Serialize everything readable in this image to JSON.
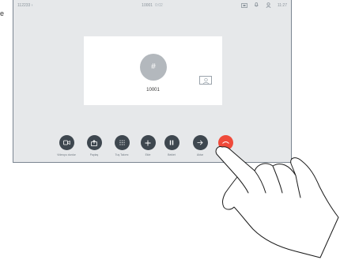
{
  "figure_letter": "e",
  "status": {
    "left": "112233",
    "center_number": "10001",
    "center_duration": "0:02",
    "time": "11:27"
  },
  "call": {
    "avatar_glyph": "#",
    "callee": "10001"
  },
  "controls": [
    {
      "label": "Videoyu durdur",
      "icon": "video-icon"
    },
    {
      "label": "Paylaş",
      "icon": "share-icon"
    },
    {
      "label": "Tuş Takımı",
      "icon": "keypad-icon"
    },
    {
      "label": "Ekle",
      "icon": "plus-icon"
    },
    {
      "label": "Beklet",
      "icon": "pause-icon"
    },
    {
      "label": "Aktar",
      "icon": "transfer-arrow-icon"
    },
    {
      "label": "",
      "icon": "end-call-icon"
    }
  ],
  "colors": {
    "control_button": "#3e474f",
    "end_button": "#ef4a3a",
    "screen_bg": "#e6e8ea"
  }
}
